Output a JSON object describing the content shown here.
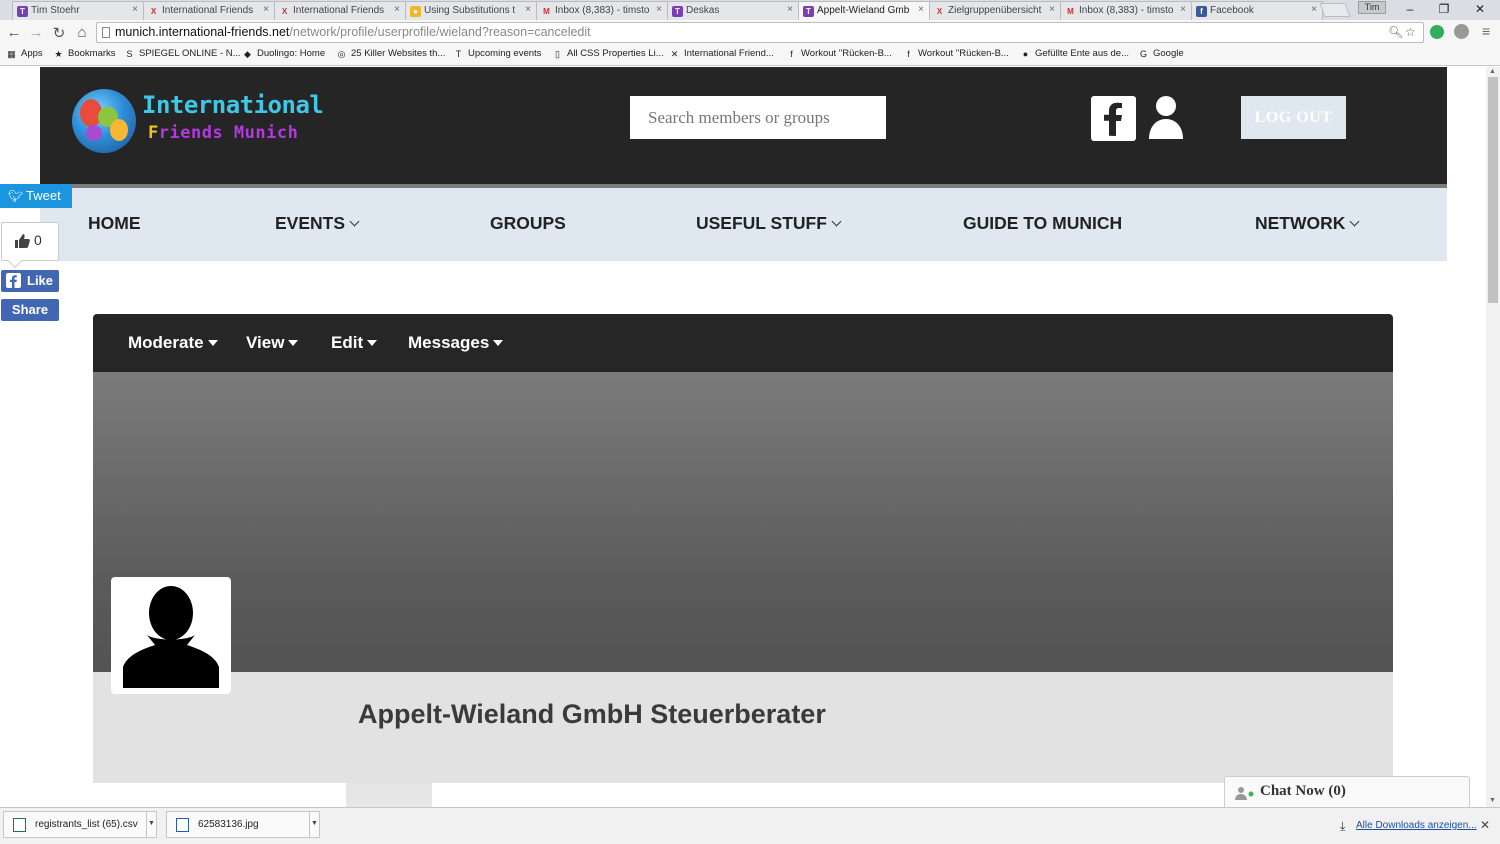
{
  "browser": {
    "tabs": [
      {
        "title": "Tim Stoehr",
        "fav": "T",
        "color": "#7a3fb4",
        "active": false
      },
      {
        "title": "International Friends",
        "fav": "X",
        "color": "#ffffff",
        "active": false
      },
      {
        "title": "International Friends",
        "fav": "X",
        "color": "#ffffff",
        "active": false
      },
      {
        "title": "Using Substitutions t",
        "fav": "●",
        "color": "#f0b828",
        "active": false
      },
      {
        "title": "Inbox (8,383) - timsto",
        "fav": "M",
        "color": "#ffffff",
        "active": false
      },
      {
        "title": "Deskas",
        "fav": "T",
        "color": "#7a3fb4",
        "active": false
      },
      {
        "title": "Appelt-Wieland Gmb",
        "fav": "T",
        "color": "#7a3fb4",
        "active": true
      },
      {
        "title": "Zielgruppenübersicht",
        "fav": "X",
        "color": "#ffffff",
        "active": false
      },
      {
        "title": "Inbox (8,383) - timsto",
        "fav": "M",
        "color": "#ffffff",
        "active": false
      },
      {
        "title": "Facebook",
        "fav": "f",
        "color": "#3b5998",
        "active": false
      }
    ],
    "user_label": "Tim",
    "url_host": "munich.international-friends.net",
    "url_path": "/network/profile/userprofile/wieland?reason=canceledit",
    "bookmarks": [
      {
        "label": "Apps",
        "icon": "apps-icon"
      },
      {
        "label": "Bookmarks",
        "icon": "star-icon"
      },
      {
        "label": "SPIEGEL ONLINE - N...",
        "icon": "spiegel-icon"
      },
      {
        "label": "Duolingo: Home",
        "icon": "duolingo-icon"
      },
      {
        "label": "25 Killer Websites th...",
        "icon": "circle-icon"
      },
      {
        "label": "Upcoming events",
        "icon": "t-icon"
      },
      {
        "label": "All CSS Properties Li...",
        "icon": "page-icon"
      },
      {
        "label": "International Friend...",
        "icon": "x-icon"
      },
      {
        "label": "Workout \"Rücken-B...",
        "icon": "fit-icon"
      },
      {
        "label": "Workout \"Rücken-B...",
        "icon": "fit-icon"
      },
      {
        "label": "Gefüllte Ente aus de...",
        "icon": "duck-icon"
      },
      {
        "label": "Google",
        "icon": "google-icon"
      }
    ]
  },
  "site": {
    "logo_line1": "International",
    "logo_line2_first": "F",
    "logo_line2_rest": "riends Munich",
    "search_placeholder": "Search members or groups",
    "logout_label": "LOG OUT",
    "nav": [
      {
        "label": "HOME",
        "dropdown": false
      },
      {
        "label": "EVENTS",
        "dropdown": true
      },
      {
        "label": "GROUPS",
        "dropdown": false
      },
      {
        "label": "USEFUL STUFF",
        "dropdown": true
      },
      {
        "label": "GUIDE TO MUNICH",
        "dropdown": false
      },
      {
        "label": "NETWORK",
        "dropdown": true
      }
    ]
  },
  "social": {
    "tweet_label": "Tweet",
    "like_count": "0",
    "like_label": "Like",
    "share_label": "Share"
  },
  "profile": {
    "menu": [
      "Moderate",
      "View",
      "Edit",
      "Messages"
    ],
    "name": "Appelt-Wieland GmbH Steuerberater"
  },
  "chat": {
    "label": "Chat Now (0)"
  },
  "downloads": {
    "items": [
      "registrants_list (65).csv",
      "62583136.jpg"
    ],
    "show_all": "Alle Downloads anzeigen..."
  },
  "colors": {
    "header_bg": "#252525",
    "nav_bg": "#dfe8f0",
    "tweet_blue": "#1b95e0",
    "facebook_blue": "#4267b2"
  }
}
